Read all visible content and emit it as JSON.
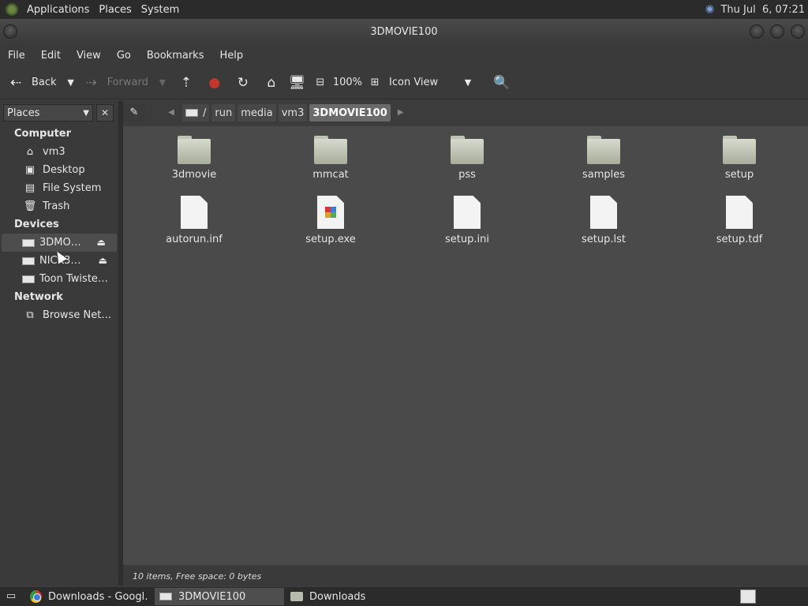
{
  "topbar": {
    "menus": [
      "Applications",
      "Places",
      "System"
    ],
    "clock": "Thu Jul  6, 07:21"
  },
  "window": {
    "title": "3DMOVIE100"
  },
  "menubar": [
    "File",
    "Edit",
    "View",
    "Go",
    "Bookmarks",
    "Help"
  ],
  "toolbar": {
    "back": "Back",
    "forward": "Forward",
    "zoom": "100%",
    "view_mode": "Icon View"
  },
  "sidebar": {
    "selector": "Places",
    "sections": {
      "computer": "Computer",
      "devices": "Devices",
      "network": "Network"
    },
    "computer_items": [
      "vm3",
      "Desktop",
      "File System",
      "Trash"
    ],
    "device_items": [
      "3DMO…",
      "NICK3…",
      "Toon Twiste…"
    ],
    "network_items": [
      "Browse Net…"
    ]
  },
  "pathbar": {
    "segments": [
      "/",
      "run",
      "media",
      "vm3",
      "3DMOVIE100"
    ]
  },
  "files": [
    {
      "name": "3dmovie",
      "type": "folder"
    },
    {
      "name": "mmcat",
      "type": "folder"
    },
    {
      "name": "pss",
      "type": "folder"
    },
    {
      "name": "samples",
      "type": "folder"
    },
    {
      "name": "setup",
      "type": "folder"
    },
    {
      "name": "autorun.inf",
      "type": "file"
    },
    {
      "name": "setup.exe",
      "type": "exe"
    },
    {
      "name": "setup.ini",
      "type": "file"
    },
    {
      "name": "setup.lst",
      "type": "file"
    },
    {
      "name": "setup.tdf",
      "type": "file"
    }
  ],
  "status": "10 items, Free space: 0 bytes",
  "taskbar": {
    "tasks": [
      "Downloads - Googl…",
      "3DMOVIE100",
      "Downloads"
    ]
  }
}
